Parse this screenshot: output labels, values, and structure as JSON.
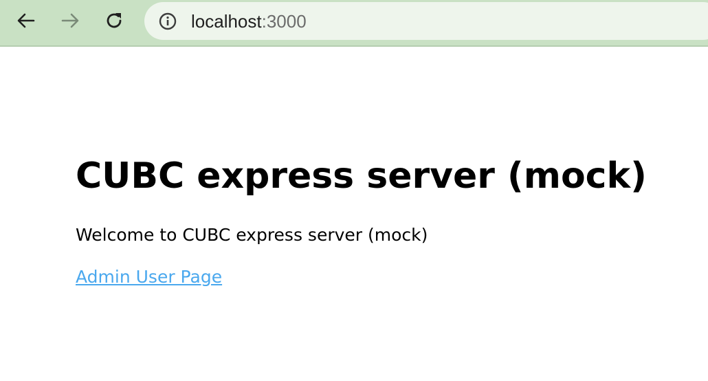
{
  "browser": {
    "url_host": "localhost",
    "url_port": ":3000",
    "icons": {
      "back": "arrow-left-icon",
      "forward": "arrow-right-icon",
      "reload": "reload-icon",
      "site_info": "info-icon"
    }
  },
  "page": {
    "heading": "CUBC express server (mock)",
    "welcome_text": "Welcome to CUBC express server (mock)",
    "admin_link_label": "Admin User Page"
  }
}
